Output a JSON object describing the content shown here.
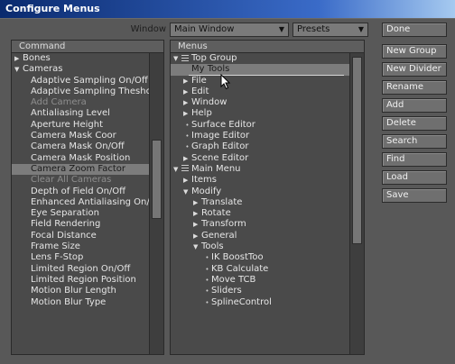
{
  "window": {
    "title": "Configure Menus"
  },
  "toolbar": {
    "window_label": "Window",
    "window_value": "Main Window",
    "presets_value": "Presets"
  },
  "buttons": [
    "Done",
    "New Group",
    "New Divider",
    "Rename",
    "Add",
    "Delete",
    "Search",
    "Find",
    "Load",
    "Save"
  ],
  "command_panel": {
    "header": "Command",
    "items": [
      {
        "label": "Bones",
        "kind": "group-collapsed"
      },
      {
        "label": "Cameras",
        "kind": "group-expanded"
      },
      {
        "label": "Adaptive Sampling On/Off",
        "kind": "item"
      },
      {
        "label": "Adaptive Sampling Thesholc",
        "kind": "item"
      },
      {
        "label": "Add Camera",
        "kind": "disabled"
      },
      {
        "label": "Antialiasing Level",
        "kind": "item"
      },
      {
        "label": "Aperture Height",
        "kind": "item"
      },
      {
        "label": "Camera Mask Coor",
        "kind": "item"
      },
      {
        "label": "Camera Mask On/Off",
        "kind": "item"
      },
      {
        "label": "Camera Mask Position",
        "kind": "item"
      },
      {
        "label": "Camera Zoom Factor",
        "kind": "selected"
      },
      {
        "label": "Clear All Cameras",
        "kind": "disabled"
      },
      {
        "label": "Depth of Field On/Off",
        "kind": "item"
      },
      {
        "label": "Enhanced Antialiasing On/Off",
        "kind": "item"
      },
      {
        "label": "Eye Separation",
        "kind": "item"
      },
      {
        "label": "Field Rendering",
        "kind": "item"
      },
      {
        "label": "Focal Distance",
        "kind": "item"
      },
      {
        "label": "Frame Size",
        "kind": "item"
      },
      {
        "label": "Lens F-Stop",
        "kind": "item"
      },
      {
        "label": "Limited Region On/Off",
        "kind": "item"
      },
      {
        "label": "Limited Region Position",
        "kind": "item"
      },
      {
        "label": "Motion Blur Length",
        "kind": "item"
      },
      {
        "label": "Motion Blur Type",
        "kind": "item"
      }
    ]
  },
  "menus_panel": {
    "header": "Menus",
    "items": [
      {
        "label": "Top Group",
        "indent": 0,
        "kind": "root-expanded"
      },
      {
        "label": "My Tools",
        "indent": 1,
        "kind": "selected"
      },
      {
        "label": "File",
        "indent": 1,
        "kind": "collapsed"
      },
      {
        "label": "Edit",
        "indent": 1,
        "kind": "collapsed"
      },
      {
        "label": "Window",
        "indent": 1,
        "kind": "collapsed"
      },
      {
        "label": "Help",
        "indent": 1,
        "kind": "collapsed"
      },
      {
        "label": "Surface Editor",
        "indent": 1,
        "kind": "leaf"
      },
      {
        "label": "Image Editor",
        "indent": 1,
        "kind": "leaf"
      },
      {
        "label": "Graph Editor",
        "indent": 1,
        "kind": "leaf"
      },
      {
        "label": "Scene Editor",
        "indent": 1,
        "kind": "collapsed"
      },
      {
        "label": "Main Menu",
        "indent": 0,
        "kind": "root-expanded"
      },
      {
        "label": "Items",
        "indent": 1,
        "kind": "collapsed"
      },
      {
        "label": "Modify",
        "indent": 1,
        "kind": "expanded"
      },
      {
        "label": "Translate",
        "indent": 2,
        "kind": "collapsed"
      },
      {
        "label": "Rotate",
        "indent": 2,
        "kind": "collapsed"
      },
      {
        "label": "Transform",
        "indent": 2,
        "kind": "collapsed"
      },
      {
        "label": "General",
        "indent": 2,
        "kind": "collapsed"
      },
      {
        "label": "Tools",
        "indent": 2,
        "kind": "expanded"
      },
      {
        "label": "IK BoostToo",
        "indent": 3,
        "kind": "leaf"
      },
      {
        "label": "KB Calculate",
        "indent": 3,
        "kind": "leaf"
      },
      {
        "label": "Move TCB",
        "indent": 3,
        "kind": "leaf"
      },
      {
        "label": "Sliders",
        "indent": 3,
        "kind": "leaf"
      },
      {
        "label": "SplineControl",
        "indent": 3,
        "kind": "leaf"
      }
    ]
  },
  "colors": {
    "title_start": "#0a2a6e",
    "title_end": "#a6caf0",
    "background": "#585858",
    "selected": "#7c7c7c"
  },
  "icons": {
    "expand": "triangle-right-icon",
    "collapse": "triangle-down-icon",
    "leaf": "bullet-icon",
    "group": "menu-group-icon",
    "cursor": "mouse-pointer-icon"
  }
}
